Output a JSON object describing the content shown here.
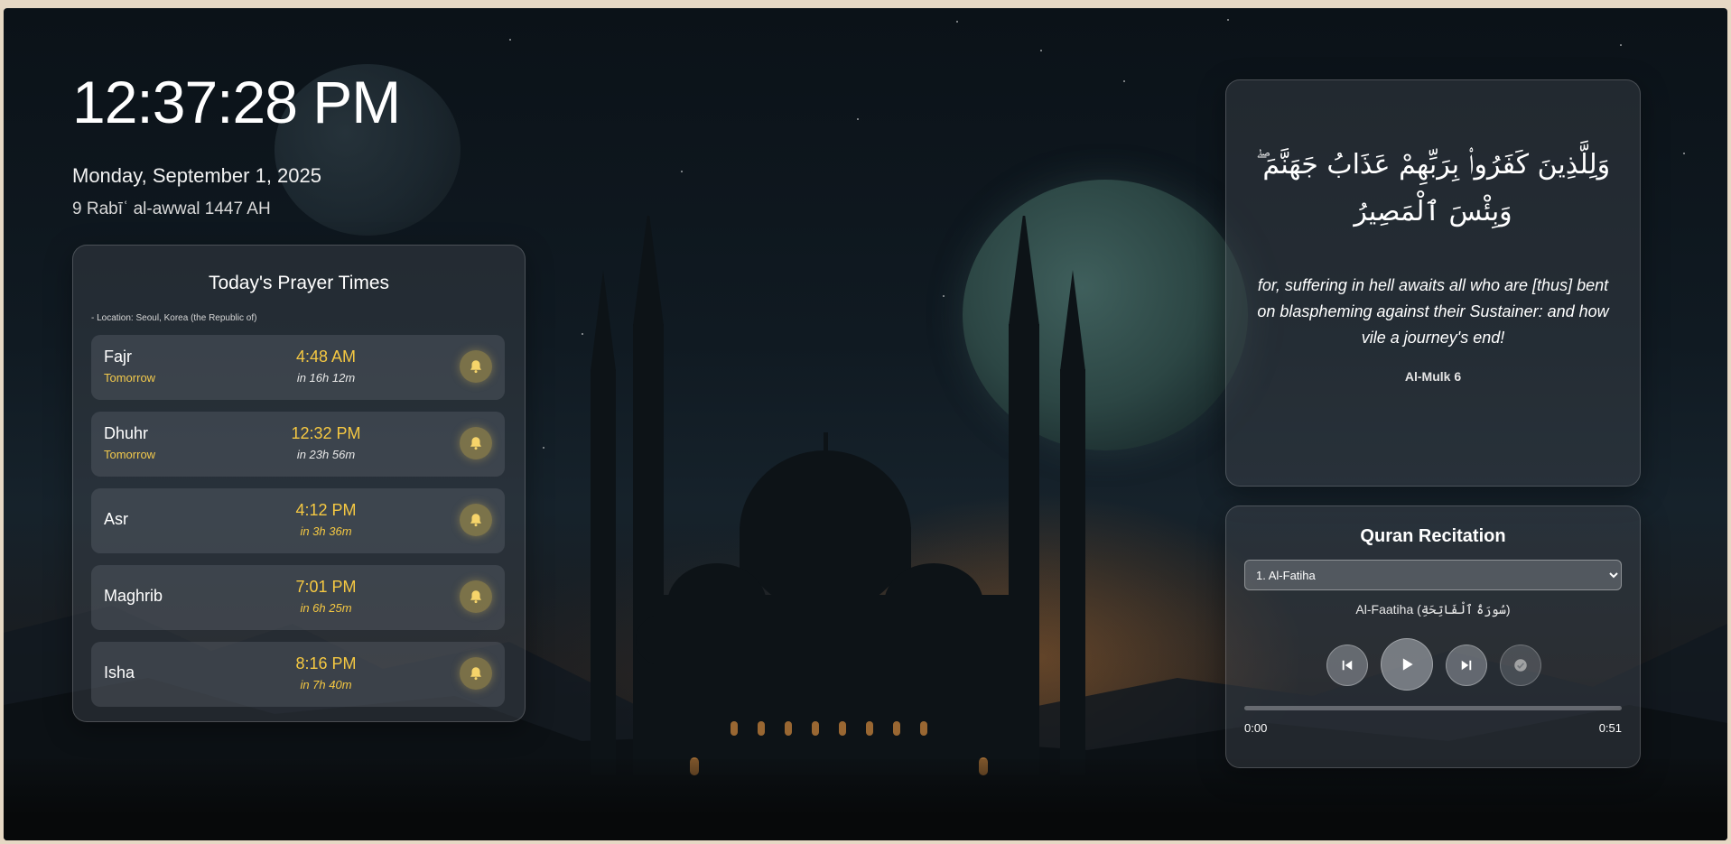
{
  "clock": {
    "time": "12:37:28 PM",
    "date": "Monday, September 1, 2025",
    "hijri": "9 Rabīʿ al-awwal 1447 AH"
  },
  "prayer_times": {
    "title": "Today's Prayer Times",
    "location": "- Location: Seoul, Korea (the Republic of)",
    "rows": [
      {
        "name": "Fajr",
        "sub": "Tomorrow",
        "time": "4:48 AM",
        "countdown": "in 16h 12m",
        "bell_icon": "bell-icon"
      },
      {
        "name": "Dhuhr",
        "sub": "Tomorrow",
        "time": "12:32 PM",
        "countdown": "in 23h 56m",
        "bell_icon": "bell-icon"
      },
      {
        "name": "Asr",
        "sub": "",
        "time": "4:12 PM",
        "countdown": "in 3h 36m",
        "bell_icon": "bell-icon"
      },
      {
        "name": "Maghrib",
        "sub": "",
        "time": "7:01 PM",
        "countdown": "in 6h 25m",
        "bell_icon": "bell-icon"
      },
      {
        "name": "Isha",
        "sub": "",
        "time": "8:16 PM",
        "countdown": "in 7h 40m",
        "bell_icon": "bell-icon"
      }
    ]
  },
  "verse": {
    "arabic": "وَلِلَّذِينَ كَفَرُوا۟ بِرَبِّهِمْ عَذَابُ جَهَنَّمَ ۖ وَبِئْسَ ٱلْمَصِيرُ",
    "translation": "for, suffering in hell awaits all who are [thus] bent on blaspheming against their Sustainer: and how vile a journey's end!",
    "reference": "Al-Mulk 6"
  },
  "recitation": {
    "title": "Quran Recitation",
    "selected_surah": "1. Al-Fatiha",
    "surah_name": "Al-Faatiha (سُورَةُ ٱلْفَاتِحَةِ)",
    "controls": [
      "previous-icon",
      "play-icon",
      "next-icon",
      "check-icon"
    ],
    "current_time": "0:00",
    "duration": "0:51",
    "progress": 0
  },
  "colors": {
    "accent_gold": "#f5c842",
    "panel_bg": "rgba(70,76,84,0.38)"
  }
}
